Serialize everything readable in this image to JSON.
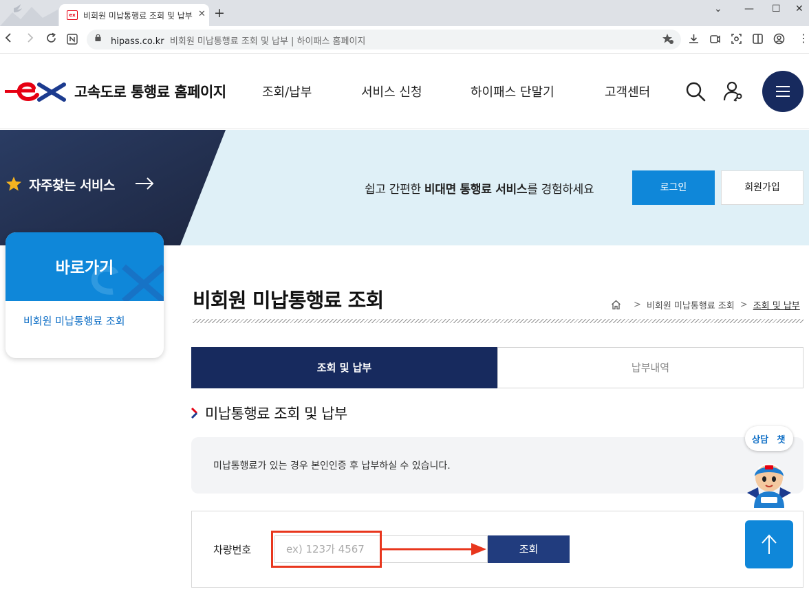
{
  "browser": {
    "tab_title": "비회원 미납통행료 조회 및 납부",
    "url_host": "hipass.co.kr",
    "url_page_title": "비회원 미납통행료 조회 및 납부 | 하이패스 홈페이지",
    "window_controls": {
      "minimize": "—",
      "maximize": "☐",
      "close": "✕"
    },
    "new_tab": "+",
    "tab_close": "✕",
    "dropdown": "⌄"
  },
  "header": {
    "logo_text": "고속도로 통행료 홈페이지",
    "nav": [
      {
        "label": "조회/납부"
      },
      {
        "label": "서비스 신청"
      },
      {
        "label": "하이패스 단말기"
      },
      {
        "label": "고객센터"
      }
    ]
  },
  "banner": {
    "favorite_label": "자주찾는 서비스",
    "message_pre": "쉽고 간편한 ",
    "message_bold": "비대면 통행료 서비스",
    "message_post": "를 경험하세요",
    "login_label": "로그인",
    "join_label": "회원가입"
  },
  "quick": {
    "title": "바로가기",
    "link": "비회원 미납통행료 조회"
  },
  "main": {
    "page_title": "비회원 미납통행료 조회",
    "breadcrumb": [
      "비회원 미납통행료 조회",
      "조회 및 납부"
    ],
    "tabs": [
      {
        "label": "조회 및 납부",
        "active": true
      },
      {
        "label": "납부내역",
        "active": false
      }
    ],
    "section_title": "미납통행료 조회 및 납부",
    "notice": "미납통행료가 있는 경우 본인인증 후 납부하실 수 있습니다.",
    "form": {
      "label": "차량번호",
      "placeholder": "ex) 123가 4567",
      "submit_label": "조회"
    }
  },
  "floating": {
    "chat_label": "상담 챗"
  },
  "colors": {
    "brand_navy": "#172a5e",
    "brand_blue": "#0f87d9",
    "logo_red": "#e60012",
    "annotation_red": "#e8361d"
  }
}
